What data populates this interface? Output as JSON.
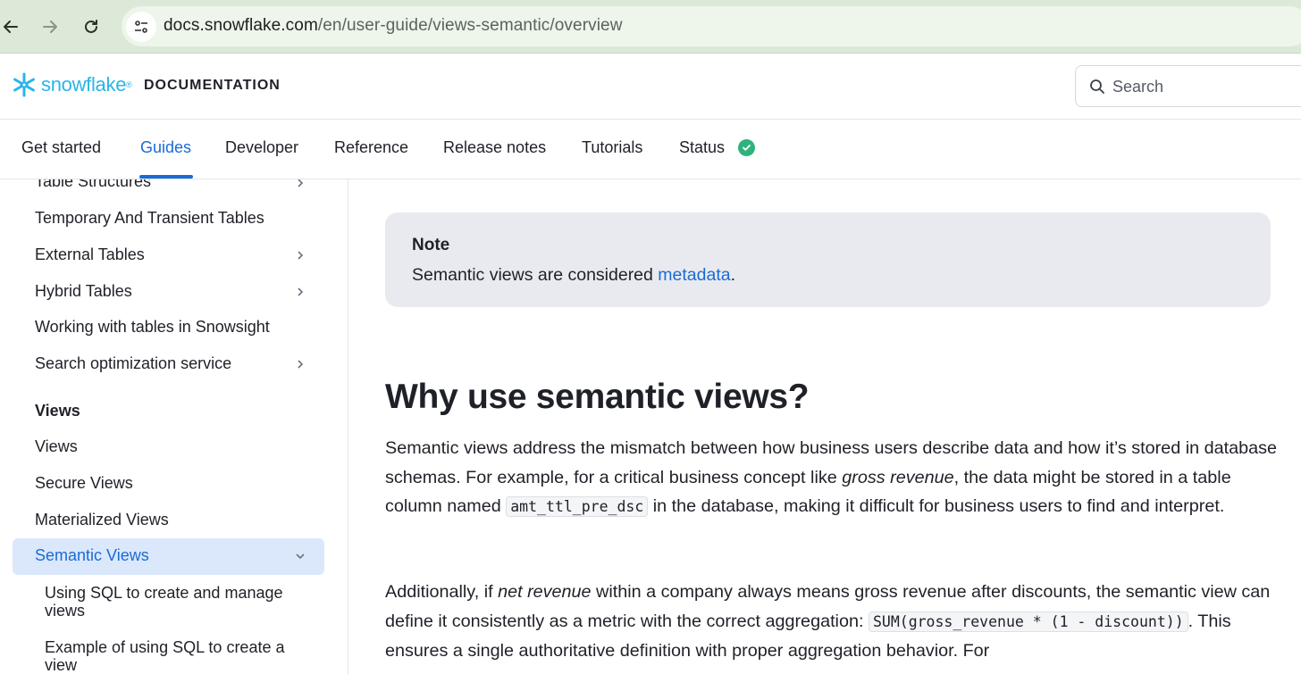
{
  "browser": {
    "url_host": "docs.snowflake.com",
    "url_path": "/en/user-guide/views-semantic/overview"
  },
  "header": {
    "logo_text": "snowflake",
    "logo_mark": "®",
    "section_label": "DOCUMENTATION",
    "search_placeholder": "Search"
  },
  "top_nav": {
    "tabs": [
      {
        "label": "Get started"
      },
      {
        "label": "Guides"
      },
      {
        "label": "Developer"
      },
      {
        "label": "Reference"
      },
      {
        "label": "Release notes"
      },
      {
        "label": "Tutorials"
      },
      {
        "label": "Status"
      }
    ],
    "active_tab": "Guides",
    "status_color": "#2fb37c"
  },
  "sidebar": {
    "items": [
      {
        "label": "Table Structures"
      },
      {
        "label": "Temporary And Transient Tables"
      },
      {
        "label": "External Tables"
      },
      {
        "label": "Hybrid Tables"
      },
      {
        "label": "Working with tables in Snowsight"
      },
      {
        "label": "Search optimization service"
      },
      {
        "label": "Views"
      },
      {
        "label": "Views"
      },
      {
        "label": "Secure Views"
      },
      {
        "label": "Materialized Views"
      },
      {
        "label": "Semantic Views"
      },
      {
        "label": "Using SQL to create and manage views"
      },
      {
        "label": "Example of using SQL to create a view"
      }
    ]
  },
  "content": {
    "note_title": "Note",
    "note_text": "Semantic views are considered ",
    "note_link": "metadata",
    "note_end": ".",
    "heading": "Why use semantic views?",
    "p1_a": "Semantic views address the mismatch between how business users describe data and how it’s stored in database schemas. For example, for a critical business concept like ",
    "p1_em": "gross revenue",
    "p1_b": ", the data might be stored in a table column named ",
    "p1_code": "amt_ttl_pre_dsc",
    "p1_c": " in the database, making it difficult for business users to find and interpret.",
    "p2_a": "Additionally, if ",
    "p2_em": "net revenue",
    "p2_b": " within a company always means gross revenue after discounts, the semantic view can define it consistently as a metric with the correct aggregation: ",
    "p2_code": "SUM(gross_revenue * (1 - discount))",
    "p2_c": ". This ensures a single authoritative definition with proper aggregation behavior. For"
  },
  "colors": {
    "accent": "#1a6bd6",
    "brand": "#29b5e8",
    "browser_bar": "#dce9d8"
  }
}
